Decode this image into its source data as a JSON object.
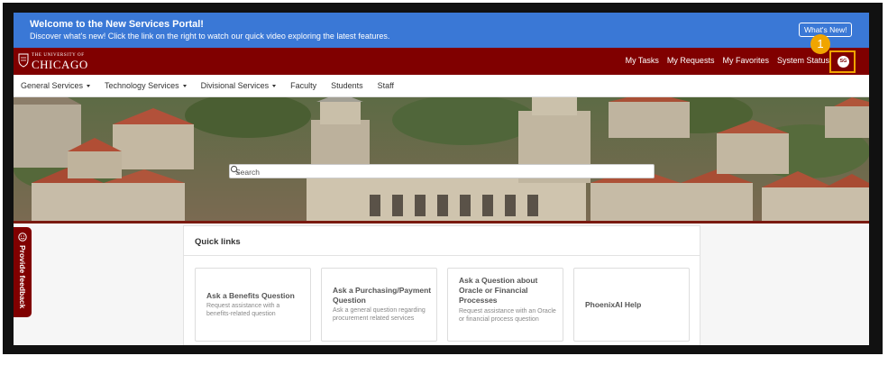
{
  "banner": {
    "title": "Welcome to the New Services Portal!",
    "text": "Discover what's new! Click the link on the right to watch our quick video exploring the latest features.",
    "button_label": "What's New!"
  },
  "header": {
    "logo_small": "THE UNIVERSITY OF",
    "logo_big": "CHICAGO",
    "links": [
      "My Tasks",
      "My Requests",
      "My Favorites",
      "System Status"
    ],
    "avatar_initials": "SG",
    "callout_number": "1",
    "highlight_color": "#f0a500",
    "brand_color": "#800000"
  },
  "nav": {
    "items": [
      {
        "label": "General Services",
        "has_dropdown": true
      },
      {
        "label": "Technology Services",
        "has_dropdown": true
      },
      {
        "label": "Divisional Services",
        "has_dropdown": true
      },
      {
        "label": "Faculty",
        "has_dropdown": false
      },
      {
        "label": "Students",
        "has_dropdown": false
      },
      {
        "label": "Staff",
        "has_dropdown": false
      }
    ]
  },
  "search": {
    "placeholder": "Search",
    "icon": "search-icon"
  },
  "quick_links": {
    "title": "Quick links",
    "cards": [
      {
        "title": "Ask a Benefits Question",
        "description": "Request assistance with a benefits-related question"
      },
      {
        "title": "Ask a Purchasing/Payment Question",
        "description": "Ask a general question regarding procurement related services"
      },
      {
        "title": "Ask a Question about Oracle or Financial Processes",
        "description": "Request assistance with an Oracle or financial process question"
      },
      {
        "title": "PhoenixAI Help",
        "description": ""
      }
    ]
  },
  "feedback": {
    "label": "Provide feedback",
    "icon": "smiley-icon"
  }
}
